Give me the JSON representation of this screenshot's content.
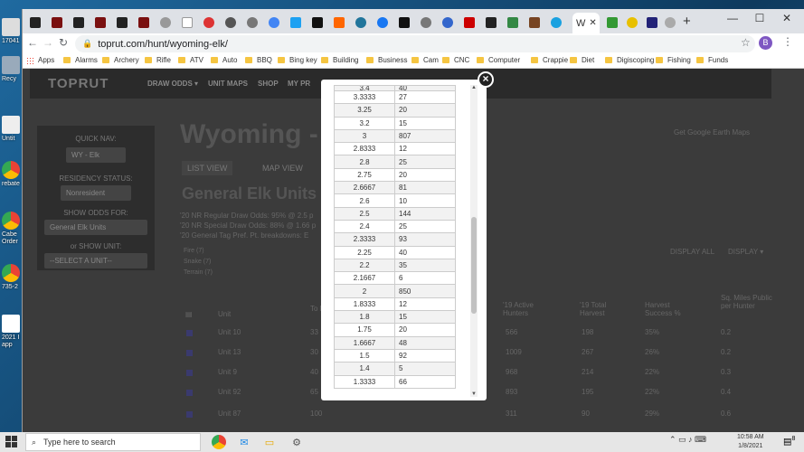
{
  "desktop": {
    "icons": [
      {
        "label": "17041"
      },
      {
        "label": "Recy"
      },
      {
        "label": "Untit"
      },
      {
        "label": "rebate"
      },
      {
        "label": "Cabe Order"
      },
      {
        "label": "735-2"
      },
      {
        "label": "2021 I app"
      }
    ]
  },
  "browser": {
    "active_tab": {
      "label": "W"
    },
    "url": "toprut.com/hunt/wyoming-elk/",
    "profile_initial": "B",
    "bookmarks": [
      "Apps",
      "Alarms",
      "Archery",
      "Rifle",
      "ATV",
      "Auto",
      "BBQ",
      "Bing key",
      "Building",
      "Business",
      "Cam",
      "CNC",
      "Computer",
      "Crappie",
      "Diet",
      "Digiscoping",
      "Fishing",
      "Funds"
    ]
  },
  "site": {
    "logo": "TOPRUT",
    "nav": [
      "DRAW ODDS ▾",
      "UNIT MAPS",
      "SHOP",
      "MY PR"
    ],
    "quick_nav_label": "QUICK NAV:",
    "quick_nav_value": "WY - Elk",
    "residency_label": "RESIDENCY STATUS:",
    "residency_value": "Nonresident",
    "show_odds_label": "SHOW ODDS FOR:",
    "show_odds_value": "General Elk Units",
    "show_unit_label": "or SHOW UNIT:",
    "show_unit_value": "--SELECT A UNIT--",
    "page_title": "Wyoming - El",
    "list_view": "LIST VIEW",
    "map_view": "MAP VIEW",
    "earth_link": "Get Google Earth Maps",
    "subtitle": "General Elk Units",
    "odds_lines": [
      "'20 NR Regular Draw Odds: 95% @ 2.5 p",
      "'20 NR Special Draw Odds: 88% @ 1.66 p",
      "'20 General Tag Pref. Pt. breakdowns: E"
    ],
    "legend": [
      "Fire (7)",
      "Snake (7)",
      "Terrain (7)"
    ],
    "display_all": "DISPLAY ALL",
    "display": "DISPLAY ▾",
    "table_headers": [
      "Unit",
      "To M",
      "'19 Active Hunters",
      "'19 Total Harvest",
      "Harvest Success %",
      "Sq. Miles Public per Hunter"
    ],
    "rows": [
      {
        "unit": "Unit 10",
        "mi": "33",
        "active": "566",
        "harvest": "198",
        "success": "35%",
        "sqmi": "0.2"
      },
      {
        "unit": "Unit 13",
        "mi": "30",
        "active": "1009",
        "harvest": "267",
        "success": "26%",
        "sqmi": "0.2"
      },
      {
        "unit": "Unit 9",
        "mi": "40",
        "active": "968",
        "harvest": "214",
        "success": "22%",
        "sqmi": "0.3"
      },
      {
        "unit": "Unit 92",
        "mi": "65",
        "active": "893",
        "harvest": "195",
        "success": "22%",
        "sqmi": "0.4"
      },
      {
        "unit": "Unit 87",
        "mi": "100",
        "active": "311",
        "harvest": "90",
        "success": "29%",
        "sqmi": "0.6"
      }
    ]
  },
  "modal": {
    "partial_top": {
      "points": "3.4",
      "count": "40"
    },
    "points_table": [
      {
        "points": "3.3333",
        "count": "27"
      },
      {
        "points": "3.25",
        "count": "20"
      },
      {
        "points": "3.2",
        "count": "15"
      },
      {
        "points": "3",
        "count": "807"
      },
      {
        "points": "2.8333",
        "count": "12"
      },
      {
        "points": "2.8",
        "count": "25"
      },
      {
        "points": "2.75",
        "count": "20"
      },
      {
        "points": "2.6667",
        "count": "81"
      },
      {
        "points": "2.6",
        "count": "10"
      },
      {
        "points": "2.5",
        "count": "144"
      },
      {
        "points": "2.4",
        "count": "25"
      },
      {
        "points": "2.3333",
        "count": "93"
      },
      {
        "points": "2.25",
        "count": "40"
      },
      {
        "points": "2.2",
        "count": "35"
      },
      {
        "points": "2.1667",
        "count": "6"
      },
      {
        "points": "2",
        "count": "850"
      },
      {
        "points": "1.8333",
        "count": "12"
      },
      {
        "points": "1.8",
        "count": "15"
      },
      {
        "points": "1.75",
        "count": "20"
      },
      {
        "points": "1.6667",
        "count": "48"
      },
      {
        "points": "1.5",
        "count": "92"
      },
      {
        "points": "1.4",
        "count": "5"
      },
      {
        "points": "1.3333",
        "count": "66"
      }
    ],
    "close_glyph": "×"
  },
  "taskbar": {
    "search_placeholder": "Type here to search",
    "time": "10:58 AM",
    "date": "1/8/2021",
    "notification_count": "8"
  }
}
